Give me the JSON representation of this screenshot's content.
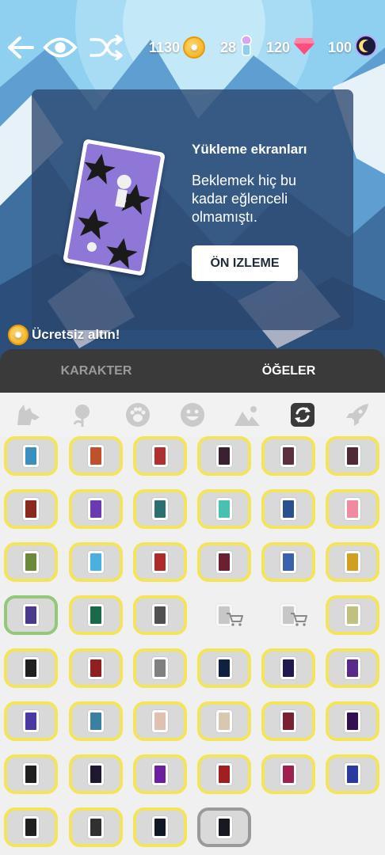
{
  "topbar": {
    "coins": "1130",
    "candy": "28",
    "gems": "120",
    "tokens": "100"
  },
  "banner": {
    "title": "Yükleme ekranları",
    "description": "Beklemek hiç bu kadar eğlenceli olmamıştı.",
    "button": "ÖN IZLEME"
  },
  "free_gold": "Ücretsiz altın!",
  "tabs": [
    "KARAKTER",
    "ÖĞELER"
  ],
  "categories": [
    "wolf-icon",
    "rose-icon",
    "paw-icon",
    "smiley-icon",
    "landscape-icon",
    "refresh-icon",
    "rocket-icon"
  ],
  "colors": {
    "item_border": "#f4e45a",
    "selected_border": "#93c77a",
    "tab_bg": "#3a3a3a",
    "gem": "#ff4d7c"
  },
  "items": [
    {
      "c": "#3a8fc0"
    },
    {
      "c": "#c0502a"
    },
    {
      "c": "#b03030"
    },
    {
      "c": "#3a2030"
    },
    {
      "c": "#5a3040"
    },
    {
      "c": "#502838"
    },
    {
      "c": "#8a2a1a"
    },
    {
      "c": "#6a3ab0"
    },
    {
      "c": "#2a7070"
    },
    {
      "c": "#4ac0b0"
    },
    {
      "c": "#2a5090"
    },
    {
      "c": "#f08aa0"
    },
    {
      "c": "#6a8a3a"
    },
    {
      "c": "#4ab0e0"
    },
    {
      "c": "#b02a2a"
    },
    {
      "c": "#6a2030"
    },
    {
      "c": "#3a60b0"
    },
    {
      "c": "#d0a020"
    },
    {
      "c": "#4a3a8a",
      "selected": true
    },
    {
      "c": "#1a6a4a"
    },
    {
      "c": "#505050"
    },
    {
      "c": "#a0a0a0",
      "shop": true
    },
    {
      "c": "#a0a0a0",
      "shop": true
    },
    {
      "c": "#c0c080"
    },
    {
      "c": "#202020"
    },
    {
      "c": "#902020"
    },
    {
      "c": "#808080"
    },
    {
      "c": "#102040"
    },
    {
      "c": "#201850"
    },
    {
      "c": "#5a2a8a"
    },
    {
      "c": "#4a3aa0"
    },
    {
      "c": "#3a80a0"
    },
    {
      "c": "#e0c0b0"
    },
    {
      "c": "#d8c8b0"
    },
    {
      "c": "#7a2030"
    },
    {
      "c": "#301050"
    },
    {
      "c": "#202020"
    },
    {
      "c": "#201830"
    },
    {
      "c": "#6a20a0"
    },
    {
      "c": "#a02020"
    },
    {
      "c": "#a02050"
    },
    {
      "c": "#2a3aa0"
    },
    {
      "c": "#202020"
    },
    {
      "c": "#303030"
    },
    {
      "c": "#101828"
    },
    {
      "c": "#181820",
      "grey": true
    }
  ]
}
